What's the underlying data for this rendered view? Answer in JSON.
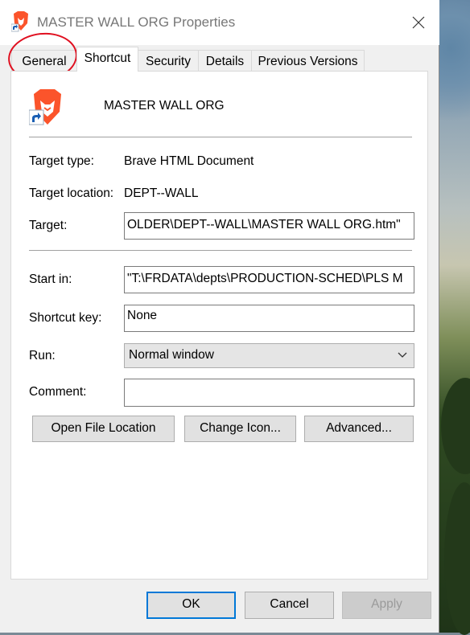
{
  "window": {
    "title": "MASTER WALL ORG Properties",
    "close_glyph": "✕"
  },
  "tabs": [
    {
      "label": "General"
    },
    {
      "label": "Shortcut"
    },
    {
      "label": "Security"
    },
    {
      "label": "Details"
    },
    {
      "label": "Previous Versions"
    }
  ],
  "active_tab": "Shortcut",
  "header": {
    "name": "MASTER WALL ORG",
    "icon": "brave-lion-shortcut-icon"
  },
  "fields": {
    "target_type_label": "Target type:",
    "target_type_value": "Brave HTML Document",
    "target_location_label": "Target location:",
    "target_location_value": "DEPT--WALL",
    "target_label": "Target:",
    "target_value": "OLDER\\DEPT--WALL\\MASTER WALL ORG.htm\"",
    "start_in_label": "Start in:",
    "start_in_value": "\"T:\\FRDATA\\depts\\PRODUCTION-SCHED\\PLS M",
    "shortcut_key_label": "Shortcut key:",
    "shortcut_key_value": "None",
    "run_label": "Run:",
    "run_value": "Normal window",
    "comment_label": "Comment:",
    "comment_value": ""
  },
  "panel_buttons": {
    "open_file_location": "Open File Location",
    "change_icon": "Change Icon...",
    "advanced": "Advanced..."
  },
  "dialog_buttons": {
    "ok": "OK",
    "cancel": "Cancel",
    "apply": "Apply"
  },
  "colors": {
    "annotation": "#e01020",
    "brave_orange": "#fb542b",
    "focus_blue": "#0078d7"
  }
}
